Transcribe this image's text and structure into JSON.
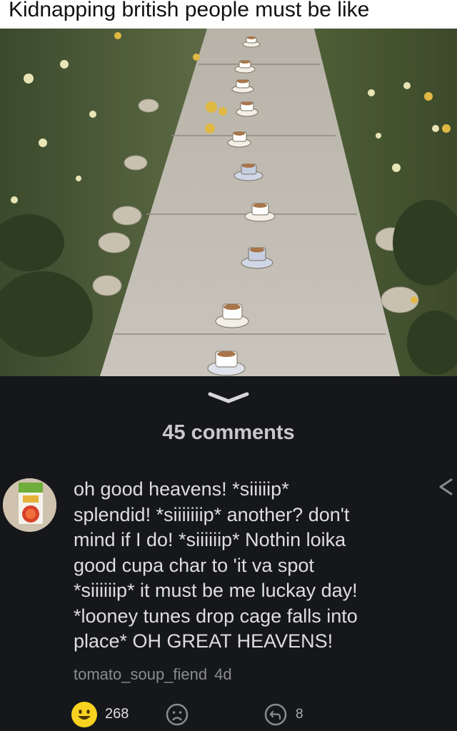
{
  "meme": {
    "caption": "Kidnapping british people must be like"
  },
  "comments": {
    "count_label": "45 comments"
  },
  "comment": {
    "text": "oh good heavens! *siiiiip*\nsplendid! *siiiiiiip* another? don't\nmind if I do! *siiiiiip* Nothin loika\ngood cupa char to 'it va spot\n*siiiiiip* it must be me luckay day!\n*looney tunes drop cage falls into\nplace* OH GREAT HEAVENS!",
    "author": "tomato_soup_fiend",
    "age": "4d",
    "happy_count": "268",
    "reply_count": "8"
  },
  "icons": {
    "collapse": "chevron-down-icon",
    "share": "share-icon",
    "happy": "smiley-face-icon",
    "sad": "sad-face-icon",
    "reply": "reply-icon"
  },
  "colors": {
    "background": "#16171b",
    "text": "#dedee0",
    "muted": "#8a8b90",
    "emoji": "#f9d21f"
  }
}
